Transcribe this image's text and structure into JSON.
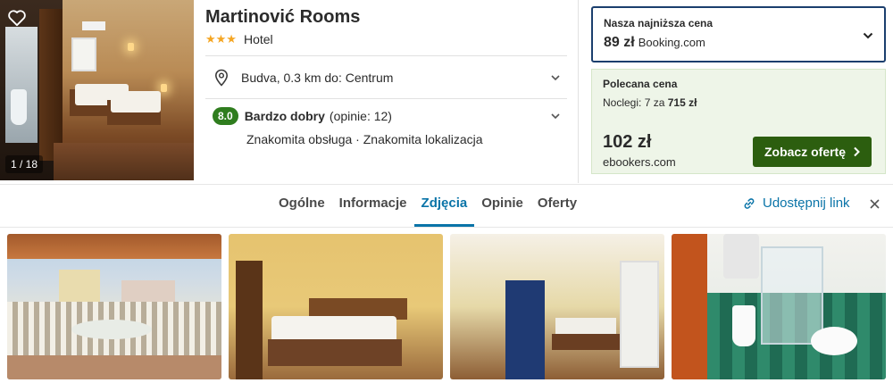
{
  "hero": {
    "photo_counter": "1 / 18"
  },
  "hotel": {
    "name": "Martinović Rooms",
    "stars": "★★★",
    "type": "Hotel",
    "location": "Budva, 0.3 km do: Centrum",
    "rating": {
      "score": "8.0",
      "label": "Bardzo dobry",
      "count": "(opinie: 12)",
      "highlights": "Znakomita obsługa · Znakomita lokalizacja"
    }
  },
  "lowest_price": {
    "label": "Nasza najniższa cena",
    "price": "89 zł",
    "provider": "Booking.com"
  },
  "recommended": {
    "label": "Polecana cena",
    "nights_prefix": "Noclegi: 7 za",
    "nights_total": "715 zł",
    "price": "102 zł",
    "provider": "ebookers.com",
    "cta": "Zobacz ofertę"
  },
  "tabs": [
    {
      "label": "Ogólne"
    },
    {
      "label": "Informacje"
    },
    {
      "label": "Zdjęcia"
    },
    {
      "label": "Opinie"
    },
    {
      "label": "Oferty"
    }
  ],
  "active_tab": "Zdjęcia",
  "share": {
    "label": "Udostępnij link"
  },
  "colors": {
    "accent_blue": "#0a74a8",
    "rating_green": "#2f7d1e",
    "cta_green": "#2c5e0f",
    "star_orange": "#f5a623",
    "lowest_border": "#1b3f6e",
    "recommended_bg": "#eef5e8"
  },
  "icons": {
    "favorite": "heart-outline-icon",
    "location": "map-pin-icon",
    "expand": "chevron-down-icon",
    "cta_arrow": "chevron-right-icon",
    "share": "link-icon",
    "close": "close-icon"
  }
}
